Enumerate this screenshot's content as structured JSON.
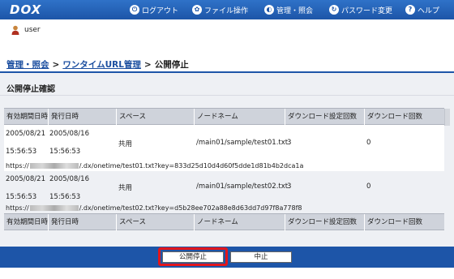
{
  "app": {
    "logo": "DOX"
  },
  "nav": [
    {
      "label": "ログアウト",
      "icon": "logout-icon",
      "glyph": "⏻"
    },
    {
      "label": "ファイル操作",
      "icon": "file-ops-icon",
      "glyph": "✿"
    },
    {
      "label": "管理・照会",
      "icon": "admin-icon",
      "glyph": "◐"
    },
    {
      "label": "パスワード変更",
      "icon": "password-icon",
      "glyph": "↻"
    },
    {
      "label": "ヘルプ",
      "icon": "help-icon",
      "glyph": "?"
    }
  ],
  "user": {
    "name": "user"
  },
  "breadcrumb": {
    "item1": "管理・照会",
    "item2": "ワンタイムURL管理",
    "current": "公開停止",
    "separator": ">"
  },
  "section": {
    "title": "公開停止確認"
  },
  "table": {
    "headers": [
      "有効期間日時",
      "発行日時",
      "スペース",
      "ノードネーム",
      "ダウンロード設定回数",
      "ダウンロード回数"
    ],
    "rows": [
      {
        "expiry_date": "2005/08/21",
        "expiry_time": "15:56:53",
        "issued_date": "2005/08/16",
        "issued_time": "15:56:53",
        "space": "共用",
        "node": "/main01/sample/test01.txt",
        "dl_setting": "3",
        "dl_count": "0",
        "url_prefix": "https://",
        "url_suffix": "/.dx/onetime/test01.txt?key=833d25d10d4d60f5dde1d81b4b2dca1a"
      },
      {
        "expiry_date": "2005/08/21",
        "expiry_time": "15:56:53",
        "issued_date": "2005/08/16",
        "issued_time": "15:56:53",
        "space": "共用",
        "node": "/main01/sample/test02.txt",
        "dl_setting": "3",
        "dl_count": "0",
        "url_prefix": "https://",
        "url_suffix": "/.dx/onetime/test02.txt?key=d5b28ee702a88e8d63dd7d97f8a778f8"
      }
    ]
  },
  "buttons": {
    "stop": "公開停止",
    "cancel": "中止"
  },
  "colors": {
    "primary": "#1d55a8",
    "highlight": "#e3161c"
  }
}
